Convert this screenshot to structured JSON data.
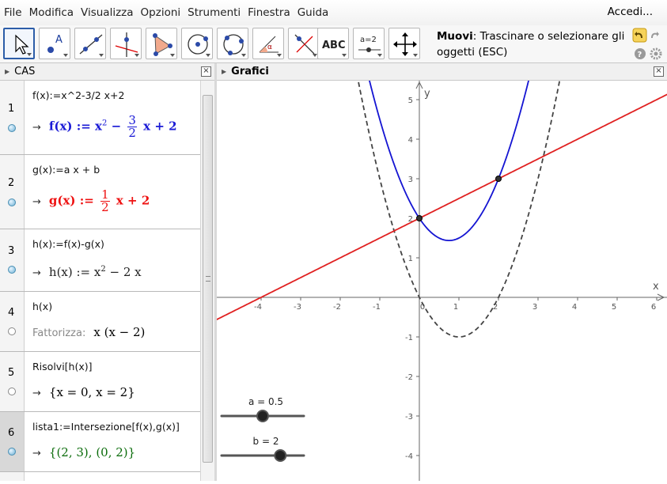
{
  "menu": {
    "items": [
      "File",
      "Modifica",
      "Visualizza",
      "Opzioni",
      "Strumenti",
      "Finestra",
      "Guida"
    ],
    "login": "Accedi..."
  },
  "toolbar": {
    "tools": [
      {
        "name": "move-tool-button",
        "icon": "pointer-icon"
      },
      {
        "name": "point-tool-button",
        "icon": "point-icon"
      },
      {
        "name": "line-tool-button",
        "icon": "line-icon"
      },
      {
        "name": "perpendicular-tool-button",
        "icon": "perpendicular-icon"
      },
      {
        "name": "polygon-tool-button",
        "icon": "polygon-icon"
      },
      {
        "name": "circle-center-point-tool-button",
        "icon": "circle-center-icon"
      },
      {
        "name": "circle-three-points-tool-button",
        "icon": "circle-three-points-icon"
      },
      {
        "name": "angle-tool-button",
        "icon": "angle-icon"
      },
      {
        "name": "reflect-tool-button",
        "icon": "reflect-icon"
      },
      {
        "name": "text-tool-button",
        "icon": "text-icon",
        "label": "ABC"
      },
      {
        "name": "slider-tool-button",
        "icon": "slider-icon",
        "label": "a=2"
      },
      {
        "name": "move-graphics-tool-button",
        "icon": "move-graphics-icon"
      }
    ],
    "help_title": "Muovi",
    "help_text": ": Trascinare o selezionare gli oggetti (ESC)"
  },
  "cas": {
    "title": "CAS",
    "close": "×",
    "rows": [
      {
        "num": "1",
        "input": "f(x):=x^2-3/2 x+2",
        "arrow": "→",
        "out_pre": "f(x) := x",
        "sup": "2",
        "out_mid": " − ",
        "frac_num": "3",
        "frac_den": "2",
        "out_post": " x + 2"
      },
      {
        "num": "2",
        "input": "g(x):=a x + b",
        "arrow": "→",
        "out_pre": "g(x) := ",
        "frac_num": "1",
        "frac_den": "2",
        "out_post": " x + 2"
      },
      {
        "num": "3",
        "input": "h(x):=f(x)-g(x)",
        "arrow": "→",
        "out_pre": "h(x) := x",
        "sup": "2",
        "out_post": " − 2 x"
      },
      {
        "num": "4",
        "input": "h(x)",
        "factor_label": "Fattorizza:",
        "out": "x (x − 2)"
      },
      {
        "num": "5",
        "input": "Risolvi[h(x)]",
        "arrow": "→",
        "out": "{x = 0, x = 2}"
      },
      {
        "num": "6",
        "input": "lista1:=Intersezione[f(x),g(x)]",
        "arrow": "→",
        "out": "{(2, 3), (0, 2)}"
      }
    ]
  },
  "graphics": {
    "title": "Grafici",
    "close": "×",
    "x_axis_label": "x",
    "y_axis_label": "y",
    "x_ticks": [
      "-4",
      "-3",
      "-2",
      "-1",
      "0",
      "1",
      "2",
      "3",
      "4",
      "5",
      "6"
    ],
    "y_ticks": [
      "5",
      "4",
      "3",
      "2",
      "1",
      "-1",
      "-2",
      "-3",
      "-4"
    ],
    "slider_a_label": "a = 0.5",
    "slider_b_label": "b = 2",
    "slider_a_value": 0.5,
    "slider_b_value": 2,
    "colors": {
      "f": "#1414d2",
      "g": "#e02020",
      "h": "#444444",
      "point": "#333333"
    }
  }
}
